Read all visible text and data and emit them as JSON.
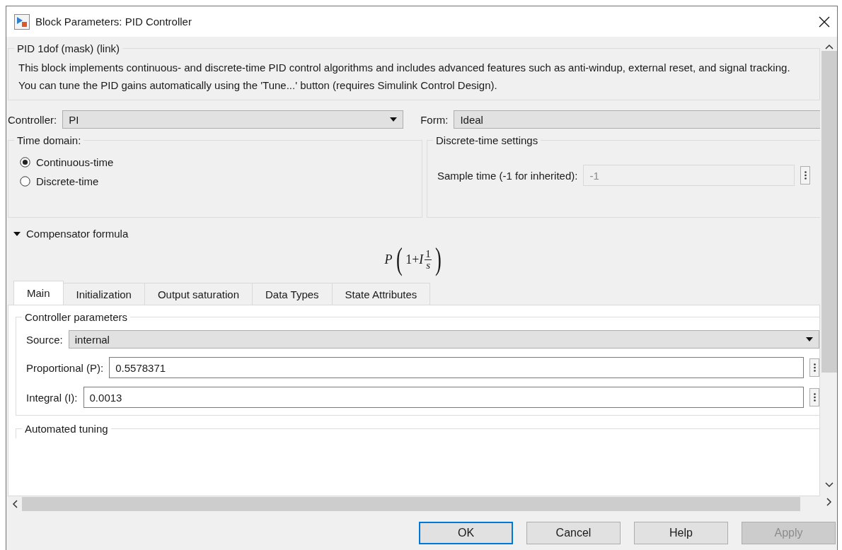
{
  "window": {
    "title": "Block Parameters: PID Controller"
  },
  "description": {
    "title": "PID 1dof (mask) (link)",
    "text": "This block implements continuous- and discrete-time PID control algorithms and includes advanced features such as anti-windup, external reset, and signal tracking. You can tune the PID gains automatically using the 'Tune...' button (requires Simulink Control Design)."
  },
  "controller": {
    "label": "Controller:",
    "value": "PI"
  },
  "form": {
    "label": "Form:",
    "value": "Ideal"
  },
  "time_domain": {
    "title": "Time domain:",
    "options": [
      {
        "label": "Continuous-time",
        "selected": true
      },
      {
        "label": "Discrete-time",
        "selected": false
      }
    ]
  },
  "discrete_settings": {
    "title": "Discrete-time settings",
    "sample_time": {
      "label": "Sample time (-1 for inherited):",
      "value": "-1",
      "disabled": true
    }
  },
  "compensator": {
    "title": "Compensator formula",
    "expanded": true,
    "formula": {
      "gain": "P",
      "open": "(",
      "sum": "1+*I*",
      "numerator": "1",
      "denominator": "s",
      "close": ")"
    }
  },
  "tabs": [
    {
      "label": "Main",
      "selected": true
    },
    {
      "label": "Initialization",
      "selected": false
    },
    {
      "label": "Output saturation",
      "selected": false
    },
    {
      "label": "Data Types",
      "selected": false
    },
    {
      "label": "State Attributes",
      "selected": false
    }
  ],
  "controller_parameters": {
    "title": "Controller parameters",
    "source": {
      "label": "Source:",
      "value": "internal"
    },
    "fields": [
      {
        "label": "Proportional (P):",
        "value": "0.5578371"
      },
      {
        "label": "Integral (I):",
        "value": "0.0013"
      }
    ]
  },
  "automated_tuning": {
    "title": "Automated tuning"
  },
  "buttons": [
    {
      "label": "OK",
      "kind": "default",
      "disabled": false
    },
    {
      "label": "Cancel",
      "kind": "normal",
      "disabled": false
    },
    {
      "label": "Help",
      "kind": "normal",
      "disabled": false
    },
    {
      "label": "Apply",
      "kind": "normal",
      "disabled": true
    }
  ]
}
